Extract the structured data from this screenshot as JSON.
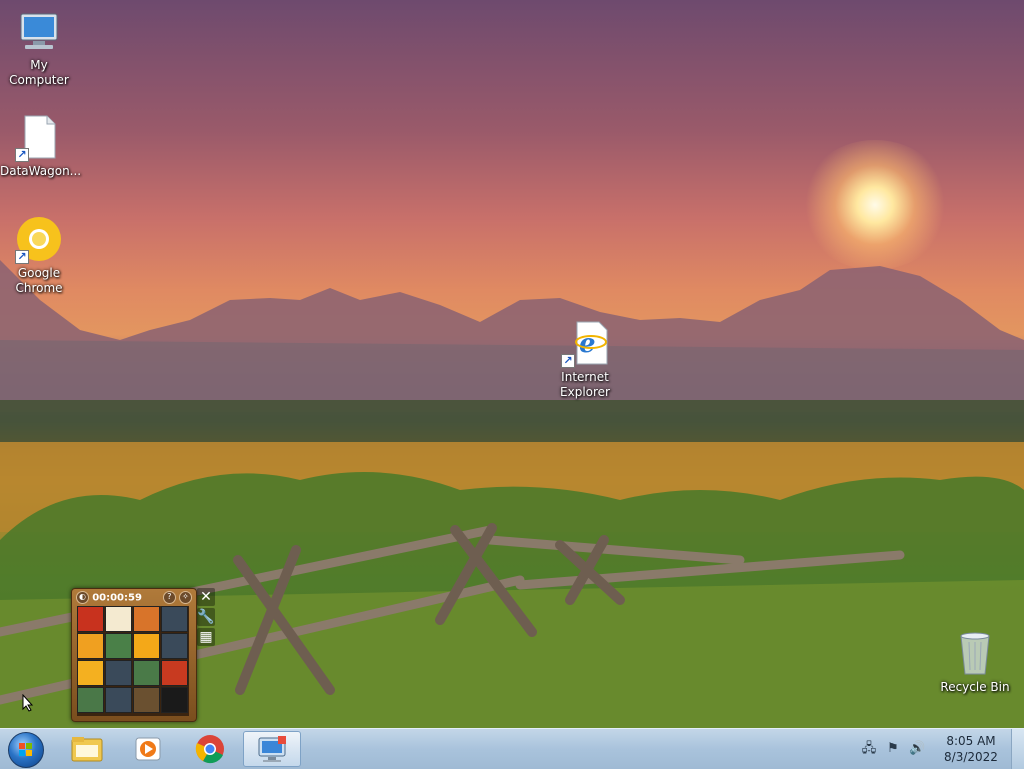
{
  "desktop": {
    "icons": [
      {
        "label": "My Computer",
        "icon": "computer-icon"
      },
      {
        "label": "DataWagon...",
        "icon": "file-shortcut-icon"
      },
      {
        "label": "Google Chrome",
        "icon": "chrome-icon"
      },
      {
        "label": "Internet Explorer",
        "icon": "internet-explorer-icon"
      },
      {
        "label": "Recycle Bin",
        "icon": "recycle-bin-icon"
      }
    ]
  },
  "puzzle_gadget": {
    "timer": "00:00:59",
    "tools": [
      "close-icon",
      "settings-wrench-icon",
      "grid-icon"
    ],
    "tile_colors": [
      [
        "#c8321e",
        "#f4ead0",
        "#d8742a",
        "#3a4a5a"
      ],
      [
        "#f0a020",
        "#4a8048",
        "#f4a818",
        "#3a4a5a"
      ],
      [
        "#f4b020",
        "#3a4a5a",
        "#4a7a48",
        "#c83a20"
      ],
      [
        "#4a7848",
        "#3a4a5a",
        "#6a5030",
        "#1a1a1a"
      ]
    ]
  },
  "taskbar": {
    "start_icon": "windows-start-orb-icon",
    "items": [
      {
        "icon": "windows-explorer-icon",
        "active": false
      },
      {
        "icon": "media-player-icon",
        "active": false
      },
      {
        "icon": "chrome-icon",
        "active": false
      },
      {
        "icon": "remote-desktop-icon",
        "active": true
      }
    ],
    "tray": {
      "icons": [
        "network-icon",
        "action-center-flag-icon",
        "volume-icon"
      ],
      "time": "8:05 AM",
      "date": "8/3/2022"
    }
  },
  "colors": {
    "taskbar_bg": "#a9c3dc",
    "desktop_label": "#ffffff"
  }
}
